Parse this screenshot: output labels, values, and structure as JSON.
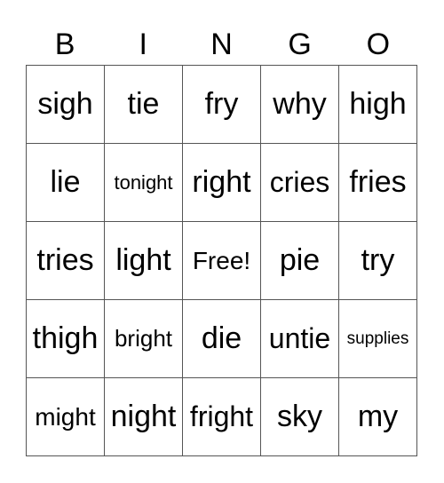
{
  "header": {
    "letters": [
      "B",
      "I",
      "N",
      "G",
      "O"
    ]
  },
  "grid": {
    "rows": [
      [
        "sigh",
        "tie",
        "fry",
        "why",
        "high"
      ],
      [
        "lie",
        "tonight",
        "right",
        "cries",
        "fries"
      ],
      [
        "tries",
        "light",
        "Free!",
        "pie",
        "try"
      ],
      [
        "thigh",
        "bright",
        "die",
        "untie",
        "supplies"
      ],
      [
        "might",
        "night",
        "fright",
        "sky",
        "my"
      ]
    ],
    "free_space": "Free!"
  }
}
